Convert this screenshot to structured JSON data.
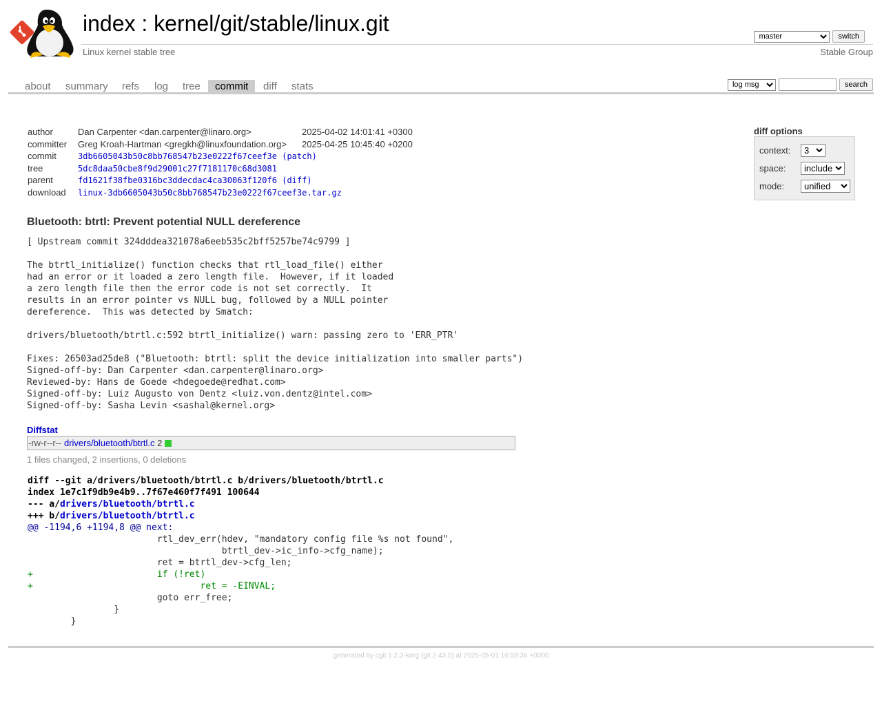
{
  "header": {
    "title_index": "index",
    "title_sep": " : ",
    "title_repo": "kernel/git/stable/linux.git",
    "subtitle": "Linux kernel stable tree",
    "owner": "Stable Group",
    "branch_selected": "master",
    "switch_label": "switch"
  },
  "tabs": [
    "about",
    "summary",
    "refs",
    "log",
    "tree",
    "commit",
    "diff",
    "stats"
  ],
  "active_tab": "commit",
  "search": {
    "scope_selected": "log msg",
    "value": "",
    "button_label": "search"
  },
  "commit_info": {
    "author_label": "author",
    "author": "Dan Carpenter <dan.carpenter@linaro.org>",
    "author_date": "2025-04-02 14:01:41 +0300",
    "committer_label": "committer",
    "committer": "Greg Kroah-Hartman <gregkh@linuxfoundation.org>",
    "committer_date": "2025-04-25 10:45:40 +0200",
    "commit_label": "commit",
    "commit": "3db6605043b50c8bb768547b23e0222f67ceef3e",
    "patch_link": "patch",
    "tree_label": "tree",
    "tree": "5dc8daa50cbe8f9d29001c27f7181170c68d3081",
    "parent_label": "parent",
    "parent": "fd1621f38fbe0316bc3ddecdac4ca30063f120f6",
    "diff_link": "diff",
    "download_label": "download",
    "download": "linux-3db6605043b50c8bb768547b23e0222f67ceef3e.tar.gz"
  },
  "diff_options": {
    "title": "diff options",
    "context_label": "context:",
    "context_value": "3",
    "space_label": "space:",
    "space_value": "include",
    "mode_label": "mode:",
    "mode_value": "unified"
  },
  "subject": "Bluetooth: btrtl: Prevent potential NULL dereference",
  "message": "[ Upstream commit 324dddea321078a6eeb535c2bff5257be74c9799 ]\n\nThe btrtl_initialize() function checks that rtl_load_file() either\nhad an error or it loaded a zero length file.  However, if it loaded\na zero length file then the error code is not set correctly.  It\nresults in an error pointer vs NULL bug, followed by a NULL pointer\ndereference.  This was detected by Smatch:\n\ndrivers/bluetooth/btrtl.c:592 btrtl_initialize() warn: passing zero to 'ERR_PTR'\n\nFixes: 26503ad25de8 (\"Bluetooth: btrtl: split the device initialization into smaller parts\")\nSigned-off-by: Dan Carpenter <dan.carpenter@linaro.org>\nReviewed-by: Hans de Goede <hdegoede@redhat.com>\nSigned-off-by: Luiz Augusto von Dentz <luiz.von.dentz@intel.com>\nSigned-off-by: Sasha Levin <sashal@kernel.org>",
  "diffstat": {
    "title": "Diffstat",
    "mode": "-rw-r--r--",
    "file": "drivers/bluetooth/btrtl.c",
    "count": "2",
    "summary": "1 files changed, 2 insertions, 0 deletions"
  },
  "diff": {
    "header": "diff --git a/drivers/bluetooth/btrtl.c b/drivers/bluetooth/btrtl.c",
    "index": "index 1e7c1f9db9e4b9..7f67e460f7f491 100644",
    "minus_prefix": "--- a/",
    "plus_prefix": "+++ b/",
    "file": "drivers/bluetooth/btrtl.c",
    "hunk": "@@ -1194,6 +1194,8 @@ next:",
    "lines": [
      {
        "type": "ctx",
        "text": "\t\t\trtl_dev_err(hdev, \"mandatory config file %s not found\","
      },
      {
        "type": "ctx",
        "text": "\t\t\t\t    btrtl_dev->ic_info->cfg_name);"
      },
      {
        "type": "ctx",
        "text": "\t\t\tret = btrtl_dev->cfg_len;"
      },
      {
        "type": "add",
        "text": "+\t\t\tif (!ret)"
      },
      {
        "type": "add",
        "text": "+\t\t\t\tret = -EINVAL;"
      },
      {
        "type": "ctx",
        "text": "\t\t\tgoto err_free;"
      },
      {
        "type": "ctx",
        "text": "\t\t}"
      },
      {
        "type": "ctx",
        "text": "\t}"
      }
    ]
  },
  "footer": {
    "prefix": "generated by ",
    "cgit_link": "cgit 1.2.3-korg",
    "suffix": " (git 2.43.0) at 2025-05-01 16:59:36 +0000"
  }
}
